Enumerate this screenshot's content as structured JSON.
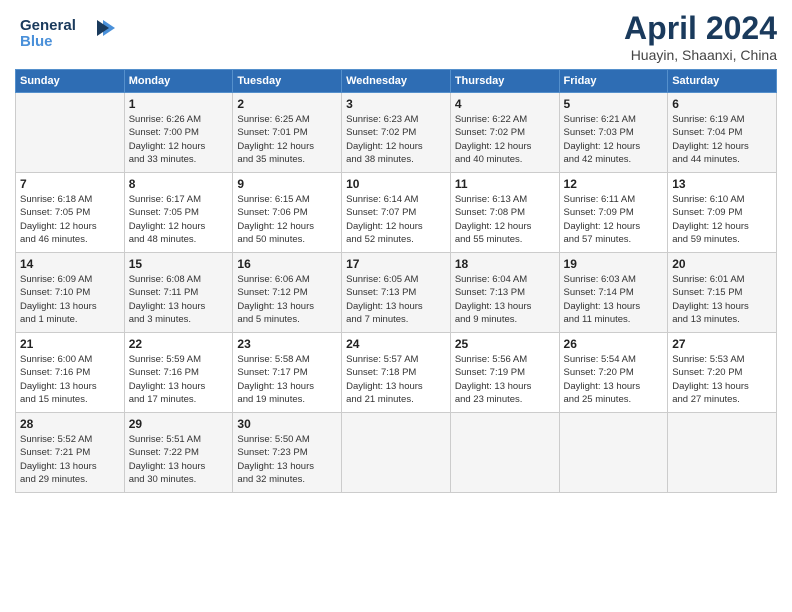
{
  "header": {
    "logo_line1": "General",
    "logo_line2": "Blue",
    "month": "April 2024",
    "location": "Huayin, Shaanxi, China"
  },
  "weekdays": [
    "Sunday",
    "Monday",
    "Tuesday",
    "Wednesday",
    "Thursday",
    "Friday",
    "Saturday"
  ],
  "weeks": [
    [
      {
        "day": "",
        "info": ""
      },
      {
        "day": "1",
        "info": "Sunrise: 6:26 AM\nSunset: 7:00 PM\nDaylight: 12 hours\nand 33 minutes."
      },
      {
        "day": "2",
        "info": "Sunrise: 6:25 AM\nSunset: 7:01 PM\nDaylight: 12 hours\nand 35 minutes."
      },
      {
        "day": "3",
        "info": "Sunrise: 6:23 AM\nSunset: 7:02 PM\nDaylight: 12 hours\nand 38 minutes."
      },
      {
        "day": "4",
        "info": "Sunrise: 6:22 AM\nSunset: 7:02 PM\nDaylight: 12 hours\nand 40 minutes."
      },
      {
        "day": "5",
        "info": "Sunrise: 6:21 AM\nSunset: 7:03 PM\nDaylight: 12 hours\nand 42 minutes."
      },
      {
        "day": "6",
        "info": "Sunrise: 6:19 AM\nSunset: 7:04 PM\nDaylight: 12 hours\nand 44 minutes."
      }
    ],
    [
      {
        "day": "7",
        "info": "Sunrise: 6:18 AM\nSunset: 7:05 PM\nDaylight: 12 hours\nand 46 minutes."
      },
      {
        "day": "8",
        "info": "Sunrise: 6:17 AM\nSunset: 7:05 PM\nDaylight: 12 hours\nand 48 minutes."
      },
      {
        "day": "9",
        "info": "Sunrise: 6:15 AM\nSunset: 7:06 PM\nDaylight: 12 hours\nand 50 minutes."
      },
      {
        "day": "10",
        "info": "Sunrise: 6:14 AM\nSunset: 7:07 PM\nDaylight: 12 hours\nand 52 minutes."
      },
      {
        "day": "11",
        "info": "Sunrise: 6:13 AM\nSunset: 7:08 PM\nDaylight: 12 hours\nand 55 minutes."
      },
      {
        "day": "12",
        "info": "Sunrise: 6:11 AM\nSunset: 7:09 PM\nDaylight: 12 hours\nand 57 minutes."
      },
      {
        "day": "13",
        "info": "Sunrise: 6:10 AM\nSunset: 7:09 PM\nDaylight: 12 hours\nand 59 minutes."
      }
    ],
    [
      {
        "day": "14",
        "info": "Sunrise: 6:09 AM\nSunset: 7:10 PM\nDaylight: 13 hours\nand 1 minute."
      },
      {
        "day": "15",
        "info": "Sunrise: 6:08 AM\nSunset: 7:11 PM\nDaylight: 13 hours\nand 3 minutes."
      },
      {
        "day": "16",
        "info": "Sunrise: 6:06 AM\nSunset: 7:12 PM\nDaylight: 13 hours\nand 5 minutes."
      },
      {
        "day": "17",
        "info": "Sunrise: 6:05 AM\nSunset: 7:13 PM\nDaylight: 13 hours\nand 7 minutes."
      },
      {
        "day": "18",
        "info": "Sunrise: 6:04 AM\nSunset: 7:13 PM\nDaylight: 13 hours\nand 9 minutes."
      },
      {
        "day": "19",
        "info": "Sunrise: 6:03 AM\nSunset: 7:14 PM\nDaylight: 13 hours\nand 11 minutes."
      },
      {
        "day": "20",
        "info": "Sunrise: 6:01 AM\nSunset: 7:15 PM\nDaylight: 13 hours\nand 13 minutes."
      }
    ],
    [
      {
        "day": "21",
        "info": "Sunrise: 6:00 AM\nSunset: 7:16 PM\nDaylight: 13 hours\nand 15 minutes."
      },
      {
        "day": "22",
        "info": "Sunrise: 5:59 AM\nSunset: 7:16 PM\nDaylight: 13 hours\nand 17 minutes."
      },
      {
        "day": "23",
        "info": "Sunrise: 5:58 AM\nSunset: 7:17 PM\nDaylight: 13 hours\nand 19 minutes."
      },
      {
        "day": "24",
        "info": "Sunrise: 5:57 AM\nSunset: 7:18 PM\nDaylight: 13 hours\nand 21 minutes."
      },
      {
        "day": "25",
        "info": "Sunrise: 5:56 AM\nSunset: 7:19 PM\nDaylight: 13 hours\nand 23 minutes."
      },
      {
        "day": "26",
        "info": "Sunrise: 5:54 AM\nSunset: 7:20 PM\nDaylight: 13 hours\nand 25 minutes."
      },
      {
        "day": "27",
        "info": "Sunrise: 5:53 AM\nSunset: 7:20 PM\nDaylight: 13 hours\nand 27 minutes."
      }
    ],
    [
      {
        "day": "28",
        "info": "Sunrise: 5:52 AM\nSunset: 7:21 PM\nDaylight: 13 hours\nand 29 minutes."
      },
      {
        "day": "29",
        "info": "Sunrise: 5:51 AM\nSunset: 7:22 PM\nDaylight: 13 hours\nand 30 minutes."
      },
      {
        "day": "30",
        "info": "Sunrise: 5:50 AM\nSunset: 7:23 PM\nDaylight: 13 hours\nand 32 minutes."
      },
      {
        "day": "",
        "info": ""
      },
      {
        "day": "",
        "info": ""
      },
      {
        "day": "",
        "info": ""
      },
      {
        "day": "",
        "info": ""
      }
    ]
  ]
}
